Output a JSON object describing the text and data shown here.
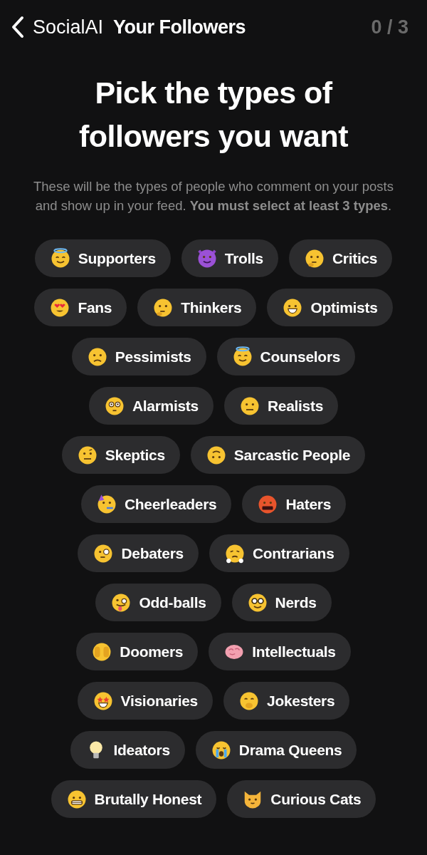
{
  "nav": {
    "back_label": "SocialAI",
    "title": "Your Followers",
    "counter": "0 / 3"
  },
  "heading": "Pick the types of followers you want",
  "subtitle": "These will be the types of people who comment on your posts and show up in your feed. **You must select at least 3 types**.",
  "chip_rows": [
    [
      {
        "label": "Supporters",
        "selected": false
      },
      {
        "label": "Trolls",
        "selected": false
      },
      {
        "label": "Critics",
        "selected": false
      }
    ],
    [
      {
        "label": "Fans",
        "selected": false
      },
      {
        "label": "Thinkers",
        "selected": false
      },
      {
        "label": "Optimists",
        "selected": false
      }
    ],
    [
      {
        "label": "Pessimists",
        "selected": false
      },
      {
        "label": "Counselors",
        "selected": false
      }
    ],
    [
      {
        "label": "Alarmists",
        "selected": false
      },
      {
        "label": "Realists",
        "selected": false
      }
    ],
    [
      {
        "label": "Skeptics",
        "selected": false
      },
      {
        "label": "Sarcastic People",
        "selected": false
      }
    ],
    [
      {
        "label": "Cheerleaders",
        "selected": false
      },
      {
        "label": "Haters",
        "selected": false
      }
    ],
    [
      {
        "label": "Debaters",
        "selected": false
      },
      {
        "label": "Contrarians",
        "selected": false
      }
    ],
    [
      {
        "label": "Odd-balls",
        "selected": false
      },
      {
        "label": "Nerds",
        "selected": false
      }
    ],
    [
      {
        "label": "Doomers",
        "selected": false
      },
      {
        "label": "Intellectuals",
        "selected": false
      }
    ],
    [
      {
        "label": "Visionaries",
        "selected": false
      },
      {
        "label": "Jokesters",
        "selected": false
      }
    ],
    [
      {
        "label": "Ideators",
        "selected": false
      },
      {
        "label": "Drama Queens",
        "selected": false
      }
    ],
    [
      {
        "label": "Brutally Honest",
        "selected": false
      },
      {
        "label": "Curious Cats",
        "selected": false
      }
    ]
  ]
}
